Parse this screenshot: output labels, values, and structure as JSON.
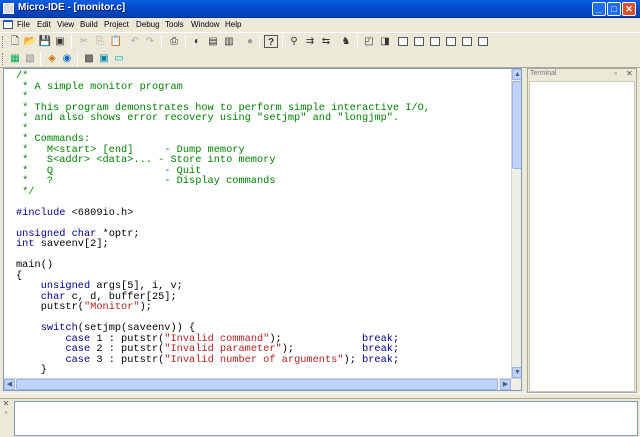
{
  "window": {
    "title": "Micro-IDE - [monitor.c]",
    "minimize": "_",
    "maximize": "□",
    "close": "✕"
  },
  "menu": {
    "items": [
      {
        "label": "File"
      },
      {
        "label": "Edit"
      },
      {
        "label": "View"
      },
      {
        "label": "Build"
      },
      {
        "label": "Project"
      },
      {
        "label": "Debug"
      },
      {
        "label": "Tools"
      },
      {
        "label": "Window"
      },
      {
        "label": "Help"
      }
    ]
  },
  "toolbar1": {
    "buttons": [
      {
        "name": "new-file-icon",
        "glyph": "🗋"
      },
      {
        "name": "open-icon",
        "glyph": "📂"
      },
      {
        "name": "save-icon",
        "glyph": "💾"
      },
      {
        "name": "save-all-icon",
        "glyph": "▣"
      },
      {
        "name": "cut-icon",
        "glyph": "✂"
      },
      {
        "name": "copy-icon",
        "glyph": "⎘"
      },
      {
        "name": "paste-icon",
        "glyph": "📋"
      },
      {
        "name": "undo-icon",
        "glyph": "↶"
      },
      {
        "name": "redo-icon",
        "glyph": "↷"
      },
      {
        "name": "print-icon",
        "glyph": "⎙"
      },
      {
        "name": "compile-icon",
        "glyph": "◐"
      },
      {
        "name": "build-icon",
        "glyph": "▤"
      },
      {
        "name": "make-icon",
        "glyph": "▥"
      },
      {
        "name": "stop-icon",
        "glyph": "●"
      },
      {
        "name": "help-icon",
        "glyph": "?"
      },
      {
        "name": "find-icon",
        "glyph": "⚲"
      },
      {
        "name": "find-next-icon",
        "glyph": "⇉"
      },
      {
        "name": "replace-icon",
        "glyph": "⇆"
      },
      {
        "name": "find-in-files-icon",
        "glyph": "♞"
      },
      {
        "name": "window-icon",
        "glyph": "◰"
      },
      {
        "name": "toggle-window-icon",
        "glyph": "◨"
      }
    ]
  },
  "toolbar2": {
    "buttons": [
      {
        "name": "project-icon",
        "glyph": "▦"
      },
      {
        "name": "project-settings-icon",
        "glyph": "▧"
      },
      {
        "name": "debug-icon",
        "glyph": "◈"
      },
      {
        "name": "breakpoint-icon",
        "glyph": "◉"
      },
      {
        "name": "target-icon",
        "glyph": "▩"
      },
      {
        "name": "terminal-icon",
        "glyph": "▣"
      },
      {
        "name": "output-icon",
        "glyph": "▭"
      }
    ]
  },
  "editor": {
    "filename": "monitor.c",
    "lines": [
      [
        {
          "c": "cm",
          "t": "/*"
        }
      ],
      [
        {
          "c": "cm",
          "t": " * A simple monitor program"
        }
      ],
      [
        {
          "c": "cm",
          "t": " *"
        }
      ],
      [
        {
          "c": "cm",
          "t": " * This program demonstrates how to perform simple interactive I/O,"
        }
      ],
      [
        {
          "c": "cm",
          "t": " * and also shows error recovery using \"setjmp\" and \"longjmp\"."
        }
      ],
      [
        {
          "c": "cm",
          "t": " *"
        }
      ],
      [
        {
          "c": "cm",
          "t": " * Commands:"
        }
      ],
      [
        {
          "c": "cm",
          "t": " *   M<start> [end]     - Dump memory"
        }
      ],
      [
        {
          "c": "cm",
          "t": " *   S<addr> <data>... - Store into memory"
        }
      ],
      [
        {
          "c": "cm",
          "t": " *   Q                  - Quit"
        }
      ],
      [
        {
          "c": "cm",
          "t": " *   ?                  - Display commands"
        }
      ],
      [
        {
          "c": "cm",
          "t": " */"
        }
      ],
      [
        {
          "c": "",
          "t": ""
        }
      ],
      [
        {
          "c": "kw",
          "t": "#include"
        },
        {
          "c": "",
          "t": " <6809io.h>"
        }
      ],
      [
        {
          "c": "",
          "t": ""
        }
      ],
      [
        {
          "c": "kw",
          "t": "unsigned char"
        },
        {
          "c": "",
          "t": " *optr;"
        }
      ],
      [
        {
          "c": "kw",
          "t": "int"
        },
        {
          "c": "",
          "t": " saveenv[2];"
        }
      ],
      [
        {
          "c": "",
          "t": ""
        }
      ],
      [
        {
          "c": "",
          "t": "main()"
        }
      ],
      [
        {
          "c": "",
          "t": "{"
        }
      ],
      [
        {
          "c": "",
          "t": "    "
        },
        {
          "c": "kw",
          "t": "unsigned"
        },
        {
          "c": "",
          "t": " args[5], i, v;"
        }
      ],
      [
        {
          "c": "",
          "t": "    "
        },
        {
          "c": "kw",
          "t": "char"
        },
        {
          "c": "",
          "t": " c, d, buffer[25];"
        }
      ],
      [
        {
          "c": "",
          "t": "    putstr("
        },
        {
          "c": "st",
          "t": "\"Monitor\""
        },
        {
          "c": "",
          "t": ");"
        }
      ],
      [
        {
          "c": "",
          "t": ""
        }
      ],
      [
        {
          "c": "",
          "t": "    "
        },
        {
          "c": "kw",
          "t": "switch"
        },
        {
          "c": "",
          "t": "(setjmp(saveenv)) {"
        }
      ],
      [
        {
          "c": "",
          "t": "        "
        },
        {
          "c": "kw",
          "t": "case"
        },
        {
          "c": "",
          "t": " 1 : putstr("
        },
        {
          "c": "st",
          "t": "\"Invalid command\""
        },
        {
          "c": "",
          "t": ");             "
        },
        {
          "c": "kw",
          "t": "break"
        },
        {
          "c": "",
          "t": ";"
        }
      ],
      [
        {
          "c": "",
          "t": "        "
        },
        {
          "c": "kw",
          "t": "case"
        },
        {
          "c": "",
          "t": " 2 : putstr("
        },
        {
          "c": "st",
          "t": "\"Invalid parameter\""
        },
        {
          "c": "",
          "t": ");           "
        },
        {
          "c": "kw",
          "t": "break"
        },
        {
          "c": "",
          "t": ";"
        }
      ],
      [
        {
          "c": "",
          "t": "        "
        },
        {
          "c": "kw",
          "t": "case"
        },
        {
          "c": "",
          "t": " 3 : putstr("
        },
        {
          "c": "st",
          "t": "\"Invalid number of arguments\""
        },
        {
          "c": "",
          "t": "); "
        },
        {
          "c": "kw",
          "t": "break"
        },
        {
          "c": "",
          "t": ";"
        }
      ],
      [
        {
          "c": "",
          "t": "    }"
        }
      ]
    ]
  },
  "terminal": {
    "label": "Terminal",
    "pin": "▫",
    "close": "✕"
  },
  "colors": {
    "comment": "#008000",
    "keyword": "#00008b",
    "string": "#b22222"
  }
}
